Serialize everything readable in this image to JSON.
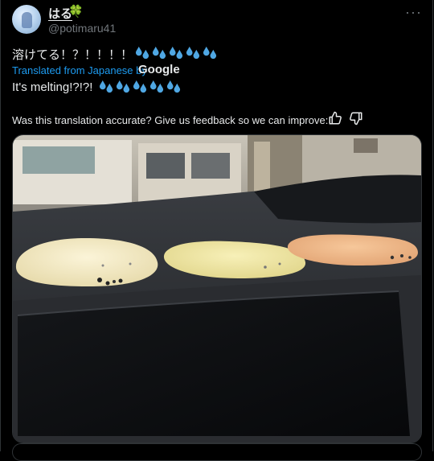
{
  "author": {
    "name": "はる",
    "name_emoji": "🍀",
    "handle": "@potimaru41"
  },
  "menu_icon": "more-horizontal-icon",
  "tweet": {
    "original_text": "溶けてる！？！！！！",
    "original_emoji": "sweat-drops-icon x5",
    "translation_label": "Translated from Japanese by",
    "translation_provider": "Google",
    "translated_text": "It's melting!?!?!",
    "translated_emoji": "sweat-drops-icon x5"
  },
  "feedback": {
    "question": "Was this translation accurate? Give us feedback so we can improve:",
    "up_icon": "thumbs-up-icon",
    "down_icon": "thumbs-down-icon"
  },
  "media": {
    "kind": "photo",
    "subject": "melted blobs on car dashboard"
  },
  "colors": {
    "background": "#000000",
    "text": "#e7e9ea",
    "secondary": "#71767b",
    "link": "#1d9bf0",
    "emoji_blue": "#4fa7e3"
  }
}
